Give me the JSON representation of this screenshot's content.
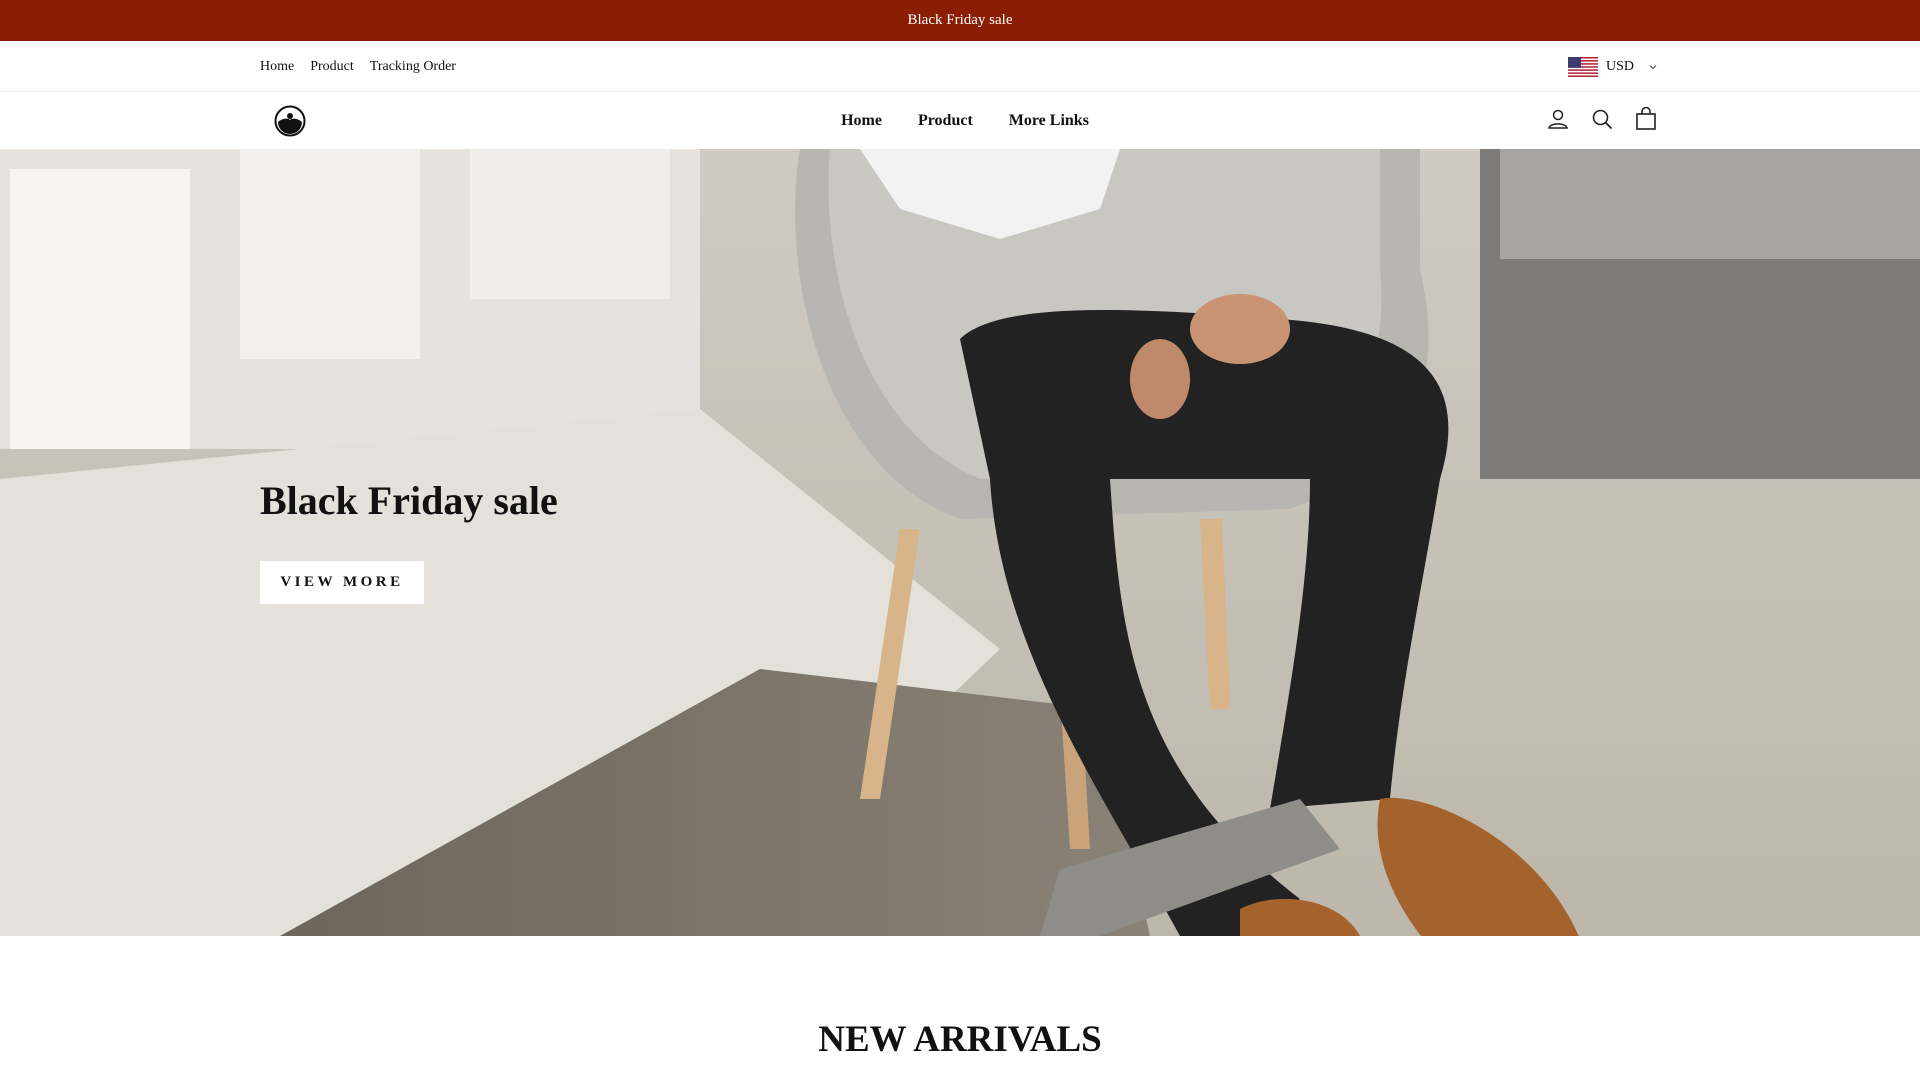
{
  "announcement": {
    "text": "Black Friday sale",
    "background": "#8b1d05"
  },
  "utility_nav": {
    "links": [
      "Home",
      "Product",
      "Tracking Order"
    ],
    "currency": {
      "code": "USD",
      "flag": "us-flag-icon"
    }
  },
  "header": {
    "logo": "store-logo",
    "nav": [
      "Home",
      "Product",
      "More Links"
    ],
    "icons": [
      "account-icon",
      "search-icon",
      "cart-icon"
    ]
  },
  "hero": {
    "title": "Black Friday sale",
    "button_label": "VIEW MORE"
  },
  "sections": {
    "new_arrivals_title": "NEW ARRIVALS"
  }
}
